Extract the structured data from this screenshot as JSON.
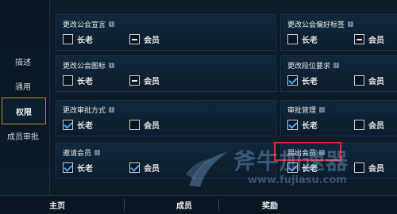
{
  "nav": {
    "items": [
      "描述",
      "通用",
      "权限",
      "成员审批"
    ]
  },
  "panels": [
    {
      "title": "更改公会宣言",
      "elder": false,
      "elder_label": "长老",
      "member": "dash",
      "member_label": "会员"
    },
    {
      "title": "更改公会偏好标签",
      "elder": false,
      "elder_label": "长老",
      "member": "dash",
      "member_label": "会员"
    },
    {
      "title": "更改公会图标",
      "elder": false,
      "elder_label": "长老",
      "member": "dash",
      "member_label": "会员"
    },
    {
      "title": "更改段位要求",
      "elder": true,
      "elder_label": "长老",
      "member": "empty",
      "member_label": "会员"
    },
    {
      "title": "更改审批方式",
      "elder": true,
      "elder_label": "长老",
      "member": "empty",
      "member_label": "会员"
    },
    {
      "title": "审批管理",
      "elder": true,
      "elder_label": "长老",
      "member": "empty",
      "member_label": "会员"
    },
    {
      "title": "邀请会员",
      "elder": true,
      "elder_label": "长老",
      "member": "checked",
      "member_label": "会员"
    },
    {
      "title": "踢出会员",
      "elder": true,
      "elder_label": "长老",
      "member": "empty",
      "member_label": "会员"
    }
  ],
  "info_glyph": "i",
  "bottom_tabs": [
    "主页",
    "成员",
    "奖励"
  ],
  "watermark": {
    "text": "斧牛加速器",
    "url": "www.fujiasu.com"
  },
  "colors": {
    "background": "#0d1a27",
    "panel": "#11283c",
    "check_blue": "#4aa7ff",
    "active_border": "#b98b2e",
    "highlight_red": "#d12d2d"
  }
}
